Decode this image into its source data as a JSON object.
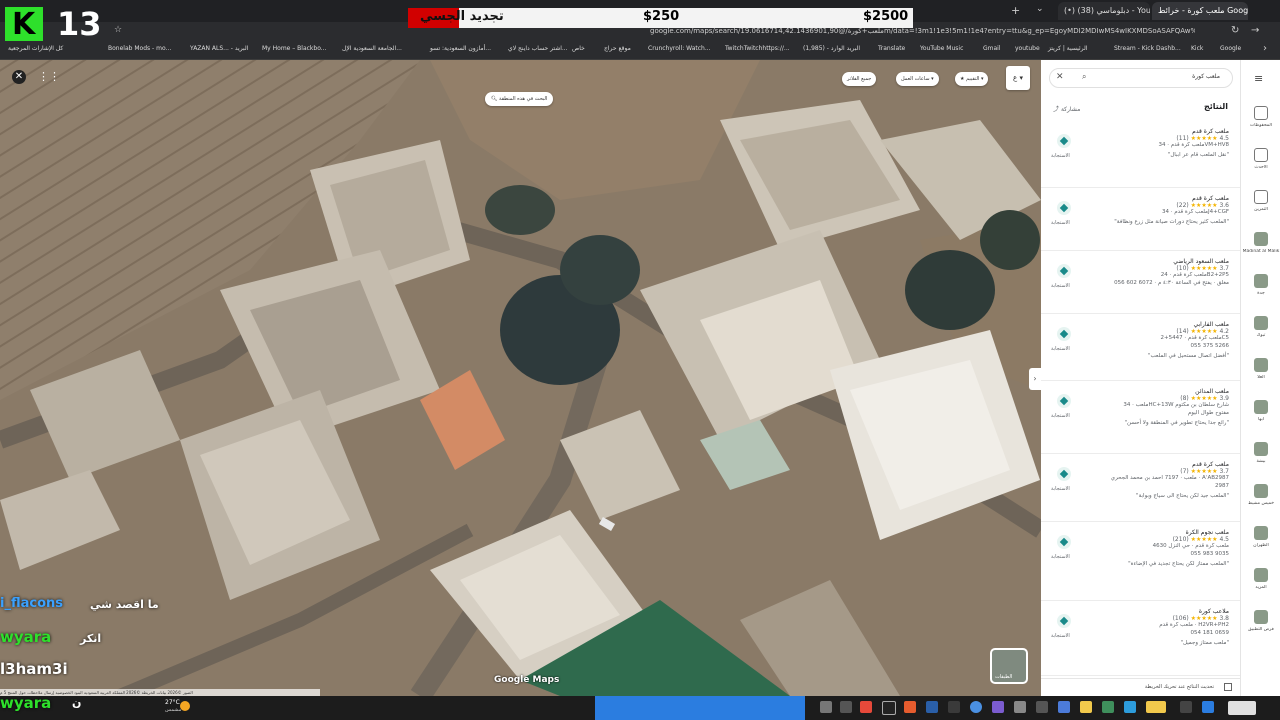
{
  "browser": {
    "tabs": [
      {
        "label": "(•) دبلوماسي (38) - YouTube"
      },
      {
        "label": "ملعب كورة - خرائط Google"
      }
    ],
    "url": "google.com/maps/search/ملعب+كورة/@19.0616714,42.1436901,90m/data=!3m1!1e3!5m1!1e4?entry=ttu&g_ep=EgoyMDI2MDIwMS4wIKXMDSoASAFQAw%3D%3D",
    "bookmarks": [
      "كل الإشارات المرجعية",
      "Bonelab Mods - mo...",
      "YAZAN ALS... - البريد",
      "My Home – Blackbo...",
      "الجامعة السعودية الإل...",
      "أمازون السعودية: تسو...",
      "اشتر حساب داينج لاي...",
      "خاص",
      "موقع حراج",
      "Crunchyroll: Watch...",
      "TwitchTwitchhttps://...",
      "(1,985) - البريد الوارد",
      "Translate",
      "YouTube Music",
      "Gmail",
      "youtube",
      "الرئيسية | كريتز",
      "Stream - Kick Dashb...",
      "Kick",
      "Google"
    ]
  },
  "overlay": {
    "logo_letter": "K",
    "counter": "13",
    "donation_label": "تجديد الجسي",
    "donation_current": "$250",
    "donation_goal": "$2500",
    "donation_progress": 0.1,
    "chat": [
      {
        "user": "i_flacons",
        "text": "ما اقصد شي",
        "color": "#3aa1ff"
      },
      {
        "user": "wyara",
        "text": "انكر",
        "color": "#2ee02b"
      },
      {
        "user": "l3ham3i",
        "text": "",
        "color": "#ffffff"
      },
      {
        "user": "wyara",
        "text": "ن",
        "color": "#2ee02b"
      }
    ]
  },
  "map": {
    "search_area_label": "البحث في هذه المنطقة",
    "filters": {
      "all_filters": "جميع الفلاتر",
      "hours": "ساعات العمل",
      "rating": "التقييم"
    },
    "watermark": "Google Maps",
    "layers_label": "الطبقات",
    "footer": "الصور ©2026 بيانات الخريطة ©2026 المملكة العربية السعودية البنود الخصوصية إرسال ملاحظات حول المنتج 5 م"
  },
  "panel": {
    "search_value": "ملعب كورة",
    "results_heading": "النتائج",
    "share_label": "مشاركة",
    "list_label": "الاستجابة",
    "results": [
      {
        "title": "ملعب كرة قدم",
        "rating": "4.5",
        "reviews": "(11)",
        "line1": "ملعب كرة قدم · 34VM+HV8",
        "line2": "",
        "quote": "\"نقل الملعب قام عر اببال\""
      },
      {
        "title": "ملعب كرة قدم",
        "rating": "3.6",
        "reviews": "(22)",
        "line1": "ملعب كرة قدم · 34J4+CGF",
        "line2": "",
        "quote": "\"الملعب كثير يحتاج دورات صيانة مثل زرع ونظافة\""
      },
      {
        "title": "ملعب السعود الرياضي",
        "rating": "3.7",
        "reviews": "(10)",
        "line1": "ملعب كرة قدم · 24B2+2P5",
        "line2": "مغلق · يفتح في الساعة ٤:٣٠ م · 6072 602 056",
        "quote": ""
      },
      {
        "title": "ملعب الفارابي",
        "rating": "4.2",
        "reviews": "(14)",
        "line1": "ملعب كرة قدم · 5447+2C5",
        "line2": "055 375 5266",
        "quote": "\"أفضل اتصال مستحيل في الملعب\""
      },
      {
        "title": "ملعب المدائن",
        "rating": "3.9",
        "reviews": "(8)",
        "line1": "ملعب · 34HC+13W شارع سلطان بن مكتوم",
        "line2": "مفتوح طوال اليوم",
        "quote": "\"رائع جدا يحتاج تطوير في المنطقة ولا أحسن\""
      },
      {
        "title": "ملعب كرة قدم",
        "rating": "3.7",
        "reviews": "(7)",
        "line1": "ملعب · 7197 احمد بن محمد الجحري · AʾAB2987",
        "line2": "2987",
        "quote": "\"الملعب جيد لكن يحتاج الى سياج وبوابة\""
      },
      {
        "title": "ملعب نجوم الكرة",
        "rating": "4.5",
        "reviews": "(210)",
        "line1": "ملعب كرة قدم · حي النزل 4630",
        "line2": "055 983 9035",
        "quote": "\"الملعب ممتاز لكن يحتاج تجديد في الإضاءة\""
      },
      {
        "title": "ملاعب كورة",
        "rating": "3.8",
        "reviews": "(106)",
        "line1": "ملعب كرة قدم · H2VR+PH2",
        "line2": "054 181 0659",
        "quote": "\"ملعب ممتاز وجميل\""
      }
    ],
    "footer_checkbox": "تحديث النتائج عند تحريك الخريطة"
  },
  "rail": {
    "items": [
      "المحفوظات",
      "الأحدث",
      "التمرين",
      "Madinat al Malik",
      "جدة",
      "تبوك",
      "العلا",
      "أبها",
      "بيشة",
      "خميس مشيط",
      "الظهران",
      "المزيد",
      "فرص التطبيق"
    ]
  },
  "taskbar": {
    "weather": "27°C",
    "weather_sub": "مشمس"
  }
}
